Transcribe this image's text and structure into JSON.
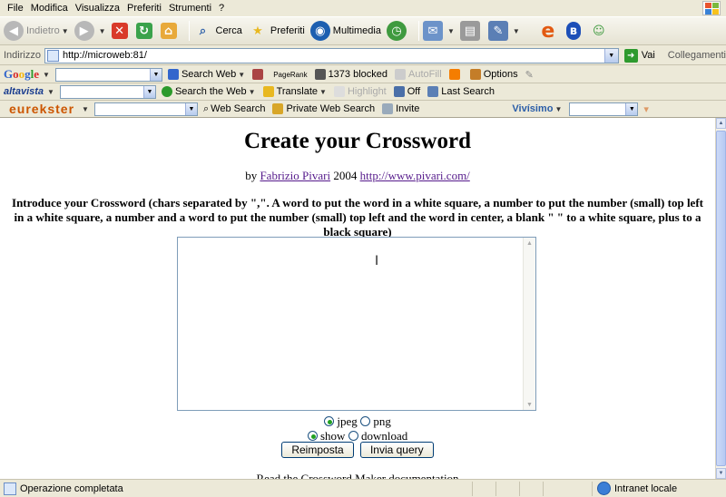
{
  "menu": [
    "File",
    "Modifica",
    "Visualizza",
    "Preferiti",
    "Strumenti",
    "?"
  ],
  "toolbar": {
    "back": "Indietro",
    "search": "Cerca",
    "favorites": "Preferiti",
    "media": "Multimedia"
  },
  "address": {
    "label": "Indirizzo",
    "url": "http://microweb:81/",
    "go": "Vai",
    "links": "Collegamenti"
  },
  "google_bar": {
    "brand": "Google",
    "search_web": "Search Web",
    "pagerank": "PageRank",
    "blocked": "1373 blocked",
    "autofill": "AutoFill",
    "options": "Options"
  },
  "altavista_bar": {
    "brand": "altavista",
    "search_web": "Search the Web",
    "translate": "Translate",
    "highlight": "Highlight",
    "off": "Off",
    "last_search": "Last Search"
  },
  "eurekster_bar": {
    "brand": "eurekster",
    "web_search": "Web Search",
    "private_search": "Private Web Search",
    "invite": "Invite",
    "vivisimo": "Vivísimo"
  },
  "page": {
    "title": "Create your Crossword",
    "by": "by",
    "author": "Fabrizio Pivari",
    "year": "2004",
    "site": "http://www.pivari.com/",
    "intro": "Introduce your Crossword (chars separated by \",\". A word to put the word in a white square, a number to put the number (small) top left in a white square, a number and a word to put the number (small) top left and the word in center, a blank \" \" to a white square, plus to a black square)",
    "textarea_value": "",
    "format_jpeg": "jpeg",
    "format_png": "png",
    "mode_show": "show",
    "mode_download": "download",
    "reset": "Reimposta",
    "submit": "Invia query",
    "bottom_partial": "Read the Crossword Maker documentation"
  },
  "status": {
    "text": "Operazione completata",
    "zone": "Intranet locale"
  },
  "colors": {
    "xp_face": "#ece9d8",
    "link_visited": "#551a8b",
    "radio_selected": "#21a121"
  }
}
